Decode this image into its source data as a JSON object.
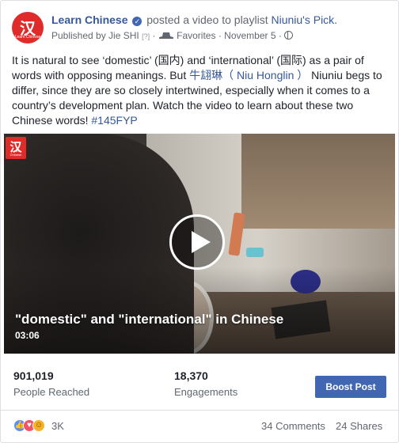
{
  "header": {
    "page_name": "Learn Chinese",
    "action_text": "posted a video to playlist",
    "playlist": "Niuniu's Pick.",
    "published_by": "Published by Jie SHI",
    "question_mark": "[?]",
    "audience_label": "Favorites",
    "date": "November 5",
    "separator": "·"
  },
  "avatar": {
    "glyph": "汉",
    "caption": "Learn Chinese"
  },
  "post": {
    "text_part1": "It is natural to see ‘domestic’ (国内) and ‘international’ (国际) as a pair of words with opposing meanings. But ",
    "mention": "牛翃琳（ Niu Honglin ）",
    "text_part2": " Niuniu begs to differ, since they are so closely intertwined, especially when it comes to a country’s development plan. Watch the video to learn about these two Chinese words! ",
    "hashtag": "#145FYP"
  },
  "video": {
    "badge_glyph": "汉",
    "badge_caption": "Learn Chinese",
    "title": "\"domestic\" and \"international\" in Chinese",
    "duration": "03:06"
  },
  "stats": {
    "reached_value": "901,019",
    "reached_label": "People Reached",
    "engagements_value": "18,370",
    "engagements_label": "Engagements",
    "boost_label": "Boost Post"
  },
  "footer": {
    "reactions_count": "3K",
    "comments": "34 Comments",
    "shares": "24 Shares"
  },
  "colors": {
    "link": "#365899",
    "brand_blue": "#4267b2",
    "logo_red": "#e02b2b"
  },
  "icons": [
    "verified-icon",
    "hat-icon",
    "globe-icon",
    "play-icon",
    "like-icon",
    "love-icon",
    "haha-icon"
  ]
}
